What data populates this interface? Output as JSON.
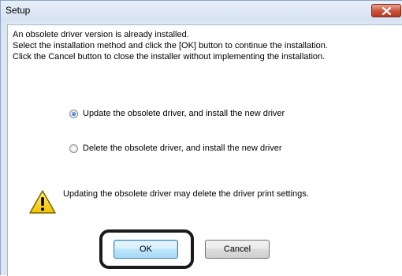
{
  "window": {
    "title": "Setup"
  },
  "message": {
    "line1": "An obsolete driver version is already installed.",
    "line2": "Select the installation method and click the [OK] button to continue the installation.",
    "line3": "Click the Cancel button to close the installer without implementing the installation."
  },
  "options": [
    {
      "label": "Update the obsolete driver, and install the new driver",
      "selected": true
    },
    {
      "label": "Delete the obsolete driver, and install the new driver",
      "selected": false
    }
  ],
  "warning": {
    "icon": "warning-icon",
    "text": "Updating the obsolete driver may delete the driver print settings."
  },
  "buttons": {
    "ok": "OK",
    "cancel": "Cancel"
  },
  "colors": {
    "title_bar": "#d6e2f1",
    "close_button": "#c9533a",
    "ok_button_accent": "#3c7fb1",
    "highlight_ring": "#1b1b1b"
  }
}
